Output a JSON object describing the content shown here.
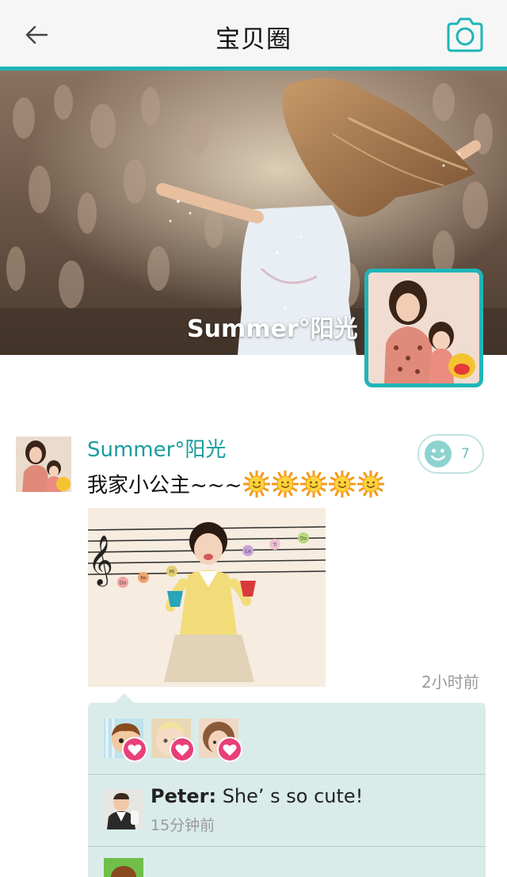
{
  "header": {
    "title": "宝贝圈",
    "back_icon": "arrow-left-icon",
    "camera_icon": "camera-icon",
    "accent_color": "#1fb5b8"
  },
  "cover": {
    "user_name": "Summer°阳光"
  },
  "post": {
    "author": "Summer°阳光",
    "text": "我家小公主~~~",
    "emoji_icon": "sun-emoji-icon",
    "emoji_count": 5,
    "like_icon": "smiley-icon",
    "like_count": "7",
    "time": "2小时前",
    "photo_labels": [
      "La",
      "Ti",
      "Do",
      "Mi",
      "Re",
      "Do"
    ]
  },
  "comments": {
    "likers": [
      {
        "avatar": "cartoon-boy-avatar"
      },
      {
        "avatar": "baby-avatar"
      },
      {
        "avatar": "girl-avatar"
      }
    ],
    "heart_icon": "heart-icon",
    "items": [
      {
        "name": "Peter:",
        "text": " She’ s so cute!",
        "time": "15分钟前"
      }
    ]
  }
}
